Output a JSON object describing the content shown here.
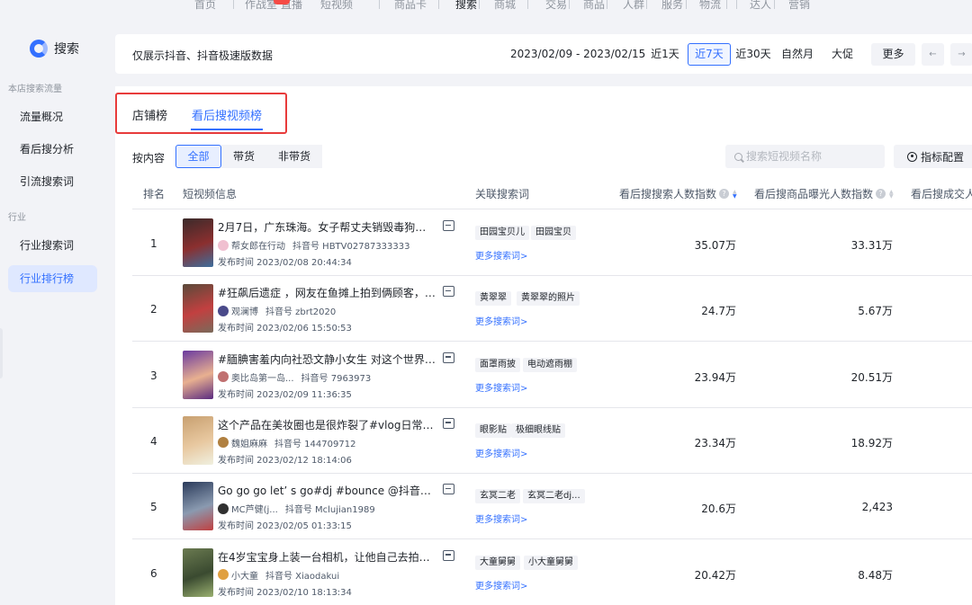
{
  "topnav": [
    "首页",
    "作战室",
    "直播",
    "短视频",
    "商品卡",
    "搜索",
    "商城",
    "交易",
    "商品",
    "人群",
    "服务",
    "物流",
    "达人",
    "营销"
  ],
  "topnav_active": "搜索",
  "sidebar": {
    "logo": "搜索",
    "group1": "本店搜索流量",
    "items1": [
      "流量概况",
      "看后搜分析",
      "引流搜索词"
    ],
    "group2": "行业",
    "items2": [
      "行业搜索词",
      "行业排行榜"
    ],
    "active": "行业排行榜"
  },
  "filterbar": {
    "note": "仅展示抖音、抖音极速版数据",
    "range": "2023/02/09 - 2023/02/15",
    "buttons": [
      "近1天",
      "近7天",
      "近30天",
      "自然月",
      "大促",
      "更多"
    ],
    "active": "近7天",
    "prev": "←",
    "next": "→"
  },
  "tabs": [
    "店铺榜",
    "看后搜视频榜"
  ],
  "active_tab": "看后搜视频榜",
  "filter": {
    "label": "按内容",
    "options": [
      "全部",
      "带货",
      "非带货"
    ],
    "active": "全部"
  },
  "search": {
    "placeholder": "搜索短视频名称"
  },
  "metric_button": "指标配置",
  "table": {
    "headers": [
      "排名",
      "短视频信息",
      "关联搜索词",
      "看后搜搜索人数指数",
      "看后搜商品曝光人数指数",
      "看后搜成交人"
    ],
    "more_label": "更多搜索词>",
    "rows": [
      {
        "rank": "1",
        "title": "2月7日，广东珠海。女子帮丈夫销毁毒狗药...",
        "author": "帮女郎在行动",
        "account": "抖音号 HBTV02787333333",
        "time": "发布时间 2023/02/08 20:44:34",
        "tags": [
          "田园宝贝儿",
          "田园宝贝"
        ],
        "search_index": "35.07万",
        "exposure_index": "33.31万",
        "thumb_colors": [
          "#3a2a2a",
          "#8b2f2f",
          "#3d6f9e"
        ],
        "avatar_color": "#f0c0d0"
      },
      {
        "rank": "2",
        "title": "#狂飙后遗症 ，网友在鱼摊上拍到俩顾客，神...",
        "author": "观澜博",
        "account": "抖音号 zbrt2020",
        "time": "发布时间 2023/02/06 15:50:53",
        "tags": [
          "黄翠翠",
          "黄翠翠的照片"
        ],
        "search_index": "24.7万",
        "exposure_index": "5.67万",
        "thumb_colors": [
          "#5a4a3a",
          "#c24040",
          "#7a6a5a"
        ],
        "avatar_color": "#4a4a8a"
      },
      {
        "rank": "3",
        "title": "#腼腆害羞内向社恐文静小女生 对这个世界很...",
        "author": "奥比岛第一岛...",
        "account": "抖音号 7963973",
        "time": "发布时间 2023/02/09 11:36:35",
        "tags": [
          "面罩雨披",
          "电动遮雨棚"
        ],
        "search_index": "23.94万",
        "exposure_index": "20.51万",
        "thumb_colors": [
          "#6a3aa0",
          "#e8b090",
          "#5a2a80"
        ],
        "avatar_color": "#c07070"
      },
      {
        "rank": "4",
        "title": "这个产品在美妆圈也是很炸裂了#vlog日常 #...",
        "author": "魏姐麻麻",
        "account": "抖音号 144709712",
        "time": "发布时间 2023/02/12 18:14:06",
        "tags": [
          "眼影贴",
          "极细眼线贴"
        ],
        "search_index": "23.34万",
        "exposure_index": "18.92万",
        "thumb_colors": [
          "#c8a070",
          "#e8c8a0",
          "#f0f0e0"
        ],
        "avatar_color": "#b08040"
      },
      {
        "rank": "5",
        "title": "Go go go let’ s go#dj #bounce @抖音小...",
        "author": "MC芦健(j...",
        "account": "抖音号 Mclujian1989",
        "time": "发布时间 2023/02/05 01:33:15",
        "tags": [
          "玄冥二老",
          "玄冥二老dj..."
        ],
        "search_index": "20.6万",
        "exposure_index": "2,423",
        "thumb_colors": [
          "#2a3a5a",
          "#8a9ab0",
          "#c04040"
        ],
        "avatar_color": "#303030"
      },
      {
        "rank": "6",
        "title": "在4岁宝宝身上装一台相机，让他自己去拍证...",
        "author": "小大童",
        "account": "抖音号 Xiaodakui",
        "time": "发布时间 2023/02/10 18:13:34",
        "tags": [
          "大童舅舅",
          "小大童舅舅"
        ],
        "search_index": "20.42万",
        "exposure_index": "8.48万",
        "thumb_colors": [
          "#6a7a50",
          "#3a4a30",
          "#9ab070"
        ],
        "avatar_color": "#e0a040"
      }
    ]
  },
  "colors": {
    "accent": "#3370ff",
    "highlight_box": "#e83b3b"
  }
}
